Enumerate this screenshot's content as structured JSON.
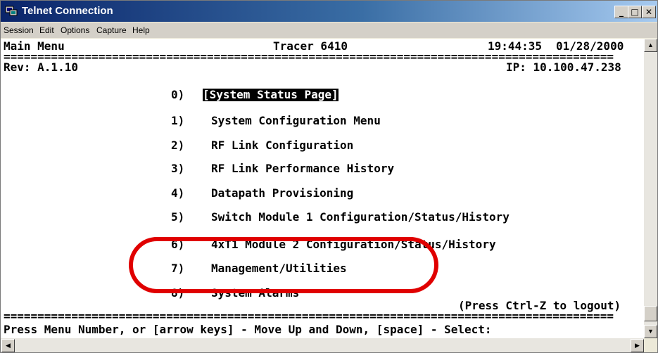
{
  "window": {
    "title": "Telnet Connection",
    "minimize_glyph": "_",
    "maximize_glyph": "□",
    "close_glyph": "✕"
  },
  "menubar": [
    "Session",
    "Edit",
    "Options",
    "Capture",
    "Help"
  ],
  "terminal": {
    "menu_title": "Main Menu",
    "device": "Tracer 6410",
    "time": "19:44:35",
    "date": "01/28/2000",
    "rev": "Rev: A.1.10",
    "ip": "IP: 10.100.47.238",
    "menu_items": [
      {
        "num": "0)",
        "label": "[System Status Page]",
        "selected": true
      },
      {
        "num": "1)",
        "label": "System Configuration Menu"
      },
      {
        "num": "2)",
        "label": "RF Link Configuration"
      },
      {
        "num": "3)",
        "label": "RF Link Performance History"
      },
      {
        "num": "4)",
        "label": "Datapath Provisioning"
      },
      {
        "num": "5)",
        "label": "Switch Module 1 Configuration/Status/History"
      },
      {
        "num": "6)",
        "label": "4xT1 Module 2 Configuration/Status/History"
      },
      {
        "num": "7)",
        "label": "Management/Utilities"
      },
      {
        "num": "8)",
        "label": "System Alarms"
      }
    ],
    "logout_hint": "(Press Ctrl-Z to logout)",
    "footer": "Press Menu Number, or [arrow keys] - Move Up and Down, [space] - Select:"
  },
  "annotation": {
    "color": "#e00000",
    "highlighted_item": "7)"
  }
}
